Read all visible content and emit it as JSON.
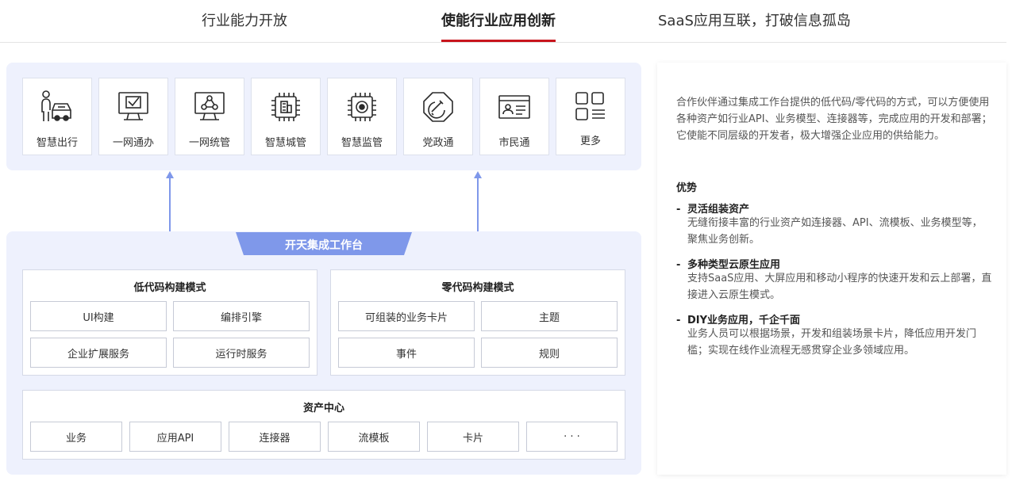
{
  "tabs": [
    {
      "label": "行业能力开放",
      "active": false
    },
    {
      "label": "使能行业应用创新",
      "active": true
    },
    {
      "label": "SaaS应用互联，打破信息孤岛",
      "active": false
    }
  ],
  "scenarios": [
    {
      "label": "智慧出行",
      "icon": "person-car-icon"
    },
    {
      "label": "一网通办",
      "icon": "monitor-check-icon"
    },
    {
      "label": "一网统管",
      "icon": "monitor-network-icon"
    },
    {
      "label": "智慧城管",
      "icon": "chip-building-icon"
    },
    {
      "label": "智慧监管",
      "icon": "chip-eye-icon"
    },
    {
      "label": "党政通",
      "icon": "party-emblem-icon"
    },
    {
      "label": "市民通",
      "icon": "id-card-icon"
    },
    {
      "label": "更多",
      "icon": "grid-more-icon"
    }
  ],
  "platform": {
    "title": "开天集成工作台"
  },
  "low_code": {
    "title": "低代码构建模式",
    "items": [
      "UI构建",
      "编排引擎",
      "企业扩展服务",
      "运行时服务"
    ]
  },
  "zero_code": {
    "title": "零代码构建模式",
    "items": [
      "可组装的业务卡片",
      "主题",
      "事件",
      "规则"
    ]
  },
  "asset_center": {
    "title": "资产中心",
    "items": [
      "业务",
      "应用API",
      "连接器",
      "流模板",
      "卡片",
      "· · ·"
    ]
  },
  "description": {
    "intro": "合作伙伴通过集成工作台提供的低代码/零代码的方式，可以方便使用各种资产如行业API、业务模型、连接器等，完成应用的开发和部署；它使能不同层级的开发者，极大增强企业应用的供给能力。",
    "advantages_title": "优势",
    "features": [
      {
        "title": "灵活组装资产",
        "desc": "无缝衔接丰富的行业资产如连接器、API、流模板、业务模型等，聚焦业务创新。"
      },
      {
        "title": "多种类型云原生应用",
        "desc": "支持SaaS应用、大屏应用和移动小程序的快速开发和云上部署，直接进入云原生模式。"
      },
      {
        "title": "DIY业务应用，千企千面",
        "desc": "业务人员可以根据场景，开发和组装场景卡片，降低应用开发门槛；实现在线作业流程无感贯穿企业多领域应用。"
      }
    ]
  },
  "colors": {
    "accent": "#c8151d",
    "panel_bg": "#eef1fd",
    "banner": "#7f98ea",
    "icon": "#2b2b2b"
  }
}
